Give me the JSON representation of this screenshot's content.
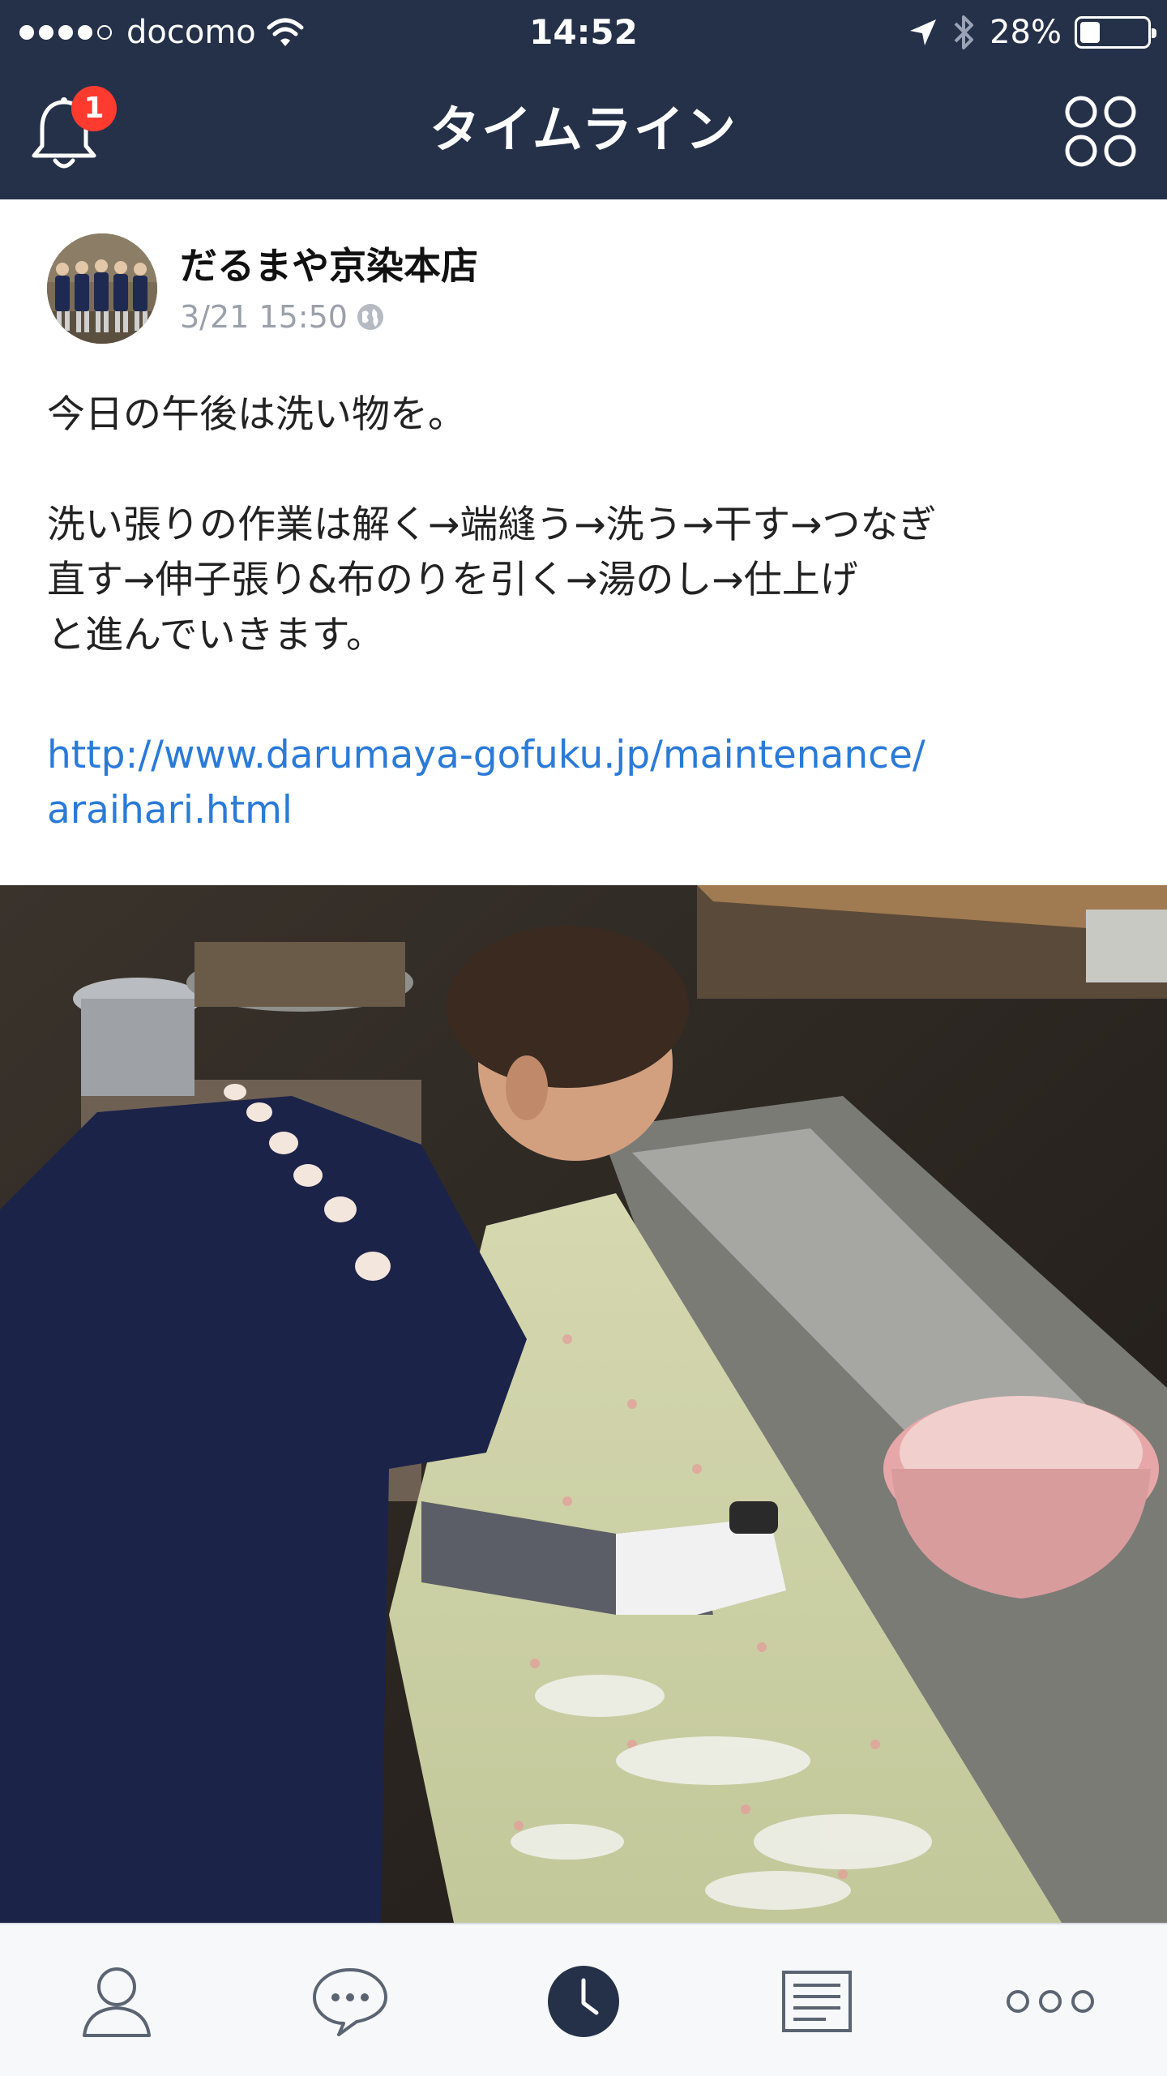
{
  "status_bar": {
    "carrier": "docomo",
    "time": "14:52",
    "battery": "28%"
  },
  "nav": {
    "title": "タイムライン",
    "notification_count": "1"
  },
  "post": {
    "author": "だるまや京染本店",
    "timestamp": "3/21 15:50",
    "lines_para1": "今日の午後は洗い物を。",
    "line2a": "洗い張りの作業は解く→端縫う→洗う→干す→つなぎ",
    "line2b": "直す→伸子張り&布のりを引く→湯のし→仕上げ",
    "line2c": "と進んでいきます。",
    "link_line1": "http://www.darumaya-gofuku.jp/maintenance/",
    "link_line2": "araihari.html"
  },
  "tabs": [
    "friends-icon",
    "chat-icon",
    "timeline-icon",
    "news-icon",
    "more-icon"
  ],
  "colors": {
    "nav_bg": "#253149",
    "link": "#2a7ad8",
    "badge": "#ff3b2f"
  }
}
